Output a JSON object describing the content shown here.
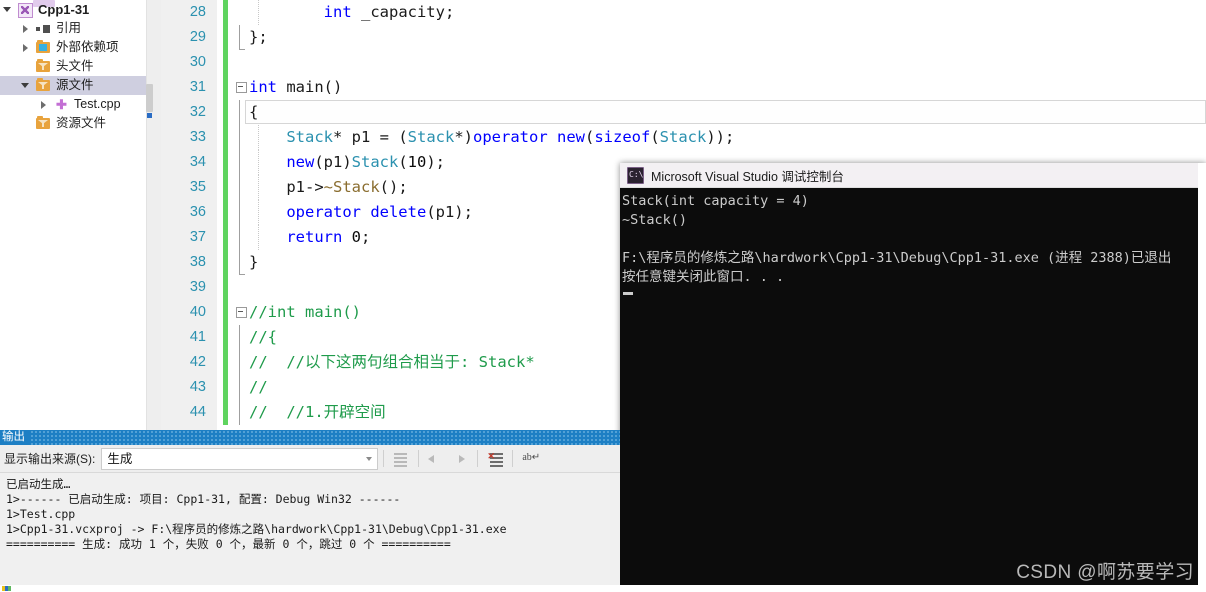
{
  "solution_explorer": {
    "items": [
      {
        "label": "Cpp1-31",
        "icon": "project-icon",
        "expander": "down",
        "indent": 18,
        "bold": true,
        "selected": false
      },
      {
        "label": "引用",
        "icon": "references-icon",
        "expander": "right",
        "indent": 36,
        "bold": false,
        "selected": false
      },
      {
        "label": "外部依赖项",
        "icon": "external-deps-icon",
        "expander": "right",
        "indent": 36,
        "bold": false,
        "selected": false
      },
      {
        "label": "头文件",
        "icon": "filter-folder-icon",
        "expander": "none",
        "indent": 36,
        "bold": false,
        "selected": false
      },
      {
        "label": "源文件",
        "icon": "filter-folder-icon",
        "expander": "down",
        "indent": 36,
        "bold": false,
        "selected": true
      },
      {
        "label": "Test.cpp",
        "icon": "cpp-file-icon",
        "expander": "right",
        "indent": 54,
        "bold": false,
        "selected": false
      },
      {
        "label": "资源文件",
        "icon": "filter-folder-icon",
        "expander": "none",
        "indent": 36,
        "bold": false,
        "selected": false
      }
    ]
  },
  "editor": {
    "lines": [
      {
        "num": "28",
        "indent_guides": [
          1
        ],
        "vbar": false,
        "fold": false,
        "current": false,
        "tokens": [
          {
            "t": "        ",
            "c": "pl"
          },
          {
            "t": "int",
            "c": "kw"
          },
          {
            "t": " _capacity;",
            "c": "pl"
          }
        ]
      },
      {
        "num": "29",
        "indent_guides": [],
        "vbar": true,
        "vbar_end": true,
        "fold": false,
        "current": false,
        "tokens": [
          {
            "t": "};",
            "c": "pl"
          }
        ]
      },
      {
        "num": "30",
        "indent_guides": [],
        "vbar": false,
        "fold": false,
        "current": false,
        "tokens": []
      },
      {
        "num": "31",
        "indent_guides": [],
        "vbar": false,
        "fold": true,
        "current": false,
        "tokens": [
          {
            "t": "int",
            "c": "kw"
          },
          {
            "t": " ",
            "c": "pl"
          },
          {
            "t": "main",
            "c": "pl"
          },
          {
            "t": "()",
            "c": "pl"
          }
        ]
      },
      {
        "num": "32",
        "indent_guides": [],
        "vbar": true,
        "fold": false,
        "current": true,
        "tokens": [
          {
            "t": "{",
            "c": "pl"
          }
        ]
      },
      {
        "num": "33",
        "indent_guides": [
          1
        ],
        "vbar": true,
        "fold": false,
        "current": false,
        "tokens": [
          {
            "t": "    ",
            "c": "pl"
          },
          {
            "t": "Stack",
            "c": "ty"
          },
          {
            "t": "* p1 = (",
            "c": "pl"
          },
          {
            "t": "Stack",
            "c": "ty"
          },
          {
            "t": "*)",
            "c": "pl"
          },
          {
            "t": "operator new",
            "c": "kw"
          },
          {
            "t": "(",
            "c": "pl"
          },
          {
            "t": "sizeof",
            "c": "kw"
          },
          {
            "t": "(",
            "c": "pl"
          },
          {
            "t": "Stack",
            "c": "ty"
          },
          {
            "t": "));",
            "c": "pl"
          }
        ]
      },
      {
        "num": "34",
        "indent_guides": [
          1
        ],
        "vbar": true,
        "fold": false,
        "current": false,
        "tokens": [
          {
            "t": "    ",
            "c": "pl"
          },
          {
            "t": "new",
            "c": "kw"
          },
          {
            "t": "(p1)",
            "c": "pl"
          },
          {
            "t": "Stack",
            "c": "ty"
          },
          {
            "t": "(",
            "c": "pl"
          },
          {
            "t": "10",
            "c": "num"
          },
          {
            "t": ");",
            "c": "pl"
          }
        ]
      },
      {
        "num": "35",
        "indent_guides": [
          1
        ],
        "vbar": true,
        "fold": false,
        "current": false,
        "tokens": [
          {
            "t": "    p1->",
            "c": "pl"
          },
          {
            "t": "~Stack",
            "c": "dtor"
          },
          {
            "t": "();",
            "c": "pl"
          }
        ]
      },
      {
        "num": "36",
        "indent_guides": [
          1
        ],
        "vbar": true,
        "fold": false,
        "current": false,
        "tokens": [
          {
            "t": "    ",
            "c": "pl"
          },
          {
            "t": "operator delete",
            "c": "kw"
          },
          {
            "t": "(p1);",
            "c": "pl"
          }
        ]
      },
      {
        "num": "37",
        "indent_guides": [
          1
        ],
        "vbar": true,
        "fold": false,
        "current": false,
        "tokens": [
          {
            "t": "    ",
            "c": "pl"
          },
          {
            "t": "return",
            "c": "kw"
          },
          {
            "t": " ",
            "c": "pl"
          },
          {
            "t": "0",
            "c": "num"
          },
          {
            "t": ";",
            "c": "pl"
          }
        ]
      },
      {
        "num": "38",
        "indent_guides": [],
        "vbar": true,
        "vbar_end": true,
        "fold": false,
        "current": false,
        "tokens": [
          {
            "t": "}",
            "c": "pl"
          }
        ]
      },
      {
        "num": "39",
        "indent_guides": [],
        "vbar": false,
        "fold": false,
        "current": false,
        "tokens": []
      },
      {
        "num": "40",
        "indent_guides": [],
        "vbar": false,
        "fold": true,
        "current": false,
        "tokens": [
          {
            "t": "//int main()",
            "c": "cm"
          }
        ]
      },
      {
        "num": "41",
        "indent_guides": [],
        "vbar": true,
        "fold": false,
        "current": false,
        "tokens": [
          {
            "t": "//{",
            "c": "cm"
          }
        ]
      },
      {
        "num": "42",
        "indent_guides": [],
        "vbar": true,
        "fold": false,
        "current": false,
        "tokens": [
          {
            "t": "//  //以下这两句组合相当于: Stack*",
            "c": "cm"
          }
        ]
      },
      {
        "num": "43",
        "indent_guides": [],
        "vbar": true,
        "fold": false,
        "current": false,
        "tokens": [
          {
            "t": "//",
            "c": "cm"
          }
        ]
      },
      {
        "num": "44",
        "indent_guides": [],
        "vbar": true,
        "fold": false,
        "current": false,
        "tokens": [
          {
            "t": "//  //1.开辟空间",
            "c": "cm"
          }
        ]
      }
    ]
  },
  "console": {
    "title": "Microsoft Visual Studio 调试控制台",
    "icon_text": "C:\\",
    "lines": [
      "Stack(int capacity = 4)",
      "~Stack()",
      "",
      "F:\\程序员的修炼之路\\hardwork\\Cpp1-31\\Debug\\Cpp1-31.exe (进程 2388)已退出",
      "按任意键关闭此窗口. . ."
    ],
    "watermark": "CSDN @啊苏要学习"
  },
  "output_panel": {
    "title": "输出",
    "source_label": "显示输出来源(S):",
    "source_value": "生成",
    "toolbar_buttons": [
      {
        "name": "find-message-in-code-icon"
      },
      {
        "name": "go-to-previous-message-icon"
      },
      {
        "name": "go-to-next-message-icon"
      },
      {
        "name": "clear-all-icon"
      },
      {
        "name": "toggle-word-wrap-icon"
      }
    ],
    "text": "已启动生成…\n1>------ 已启动生成: 项目: Cpp1-31, 配置: Debug Win32 ------\n1>Test.cpp\n1>Cpp1-31.vcxproj -> F:\\程序员的修炼之路\\hardwork\\Cpp1-31\\Debug\\Cpp1-31.exe\n========== 生成: 成功 1 个，失败 0 个，最新 0 个，跳过 0 个 =========="
  },
  "colors": {
    "accent_blue": "#1d7fc4",
    "keyword": "#0000ff",
    "type": "#2b91af",
    "comment": "#1f9b4b",
    "change_bar_green": "#5fd45f",
    "selection_gray": "#cfcfe0",
    "console_bg": "#0c0c0c"
  }
}
